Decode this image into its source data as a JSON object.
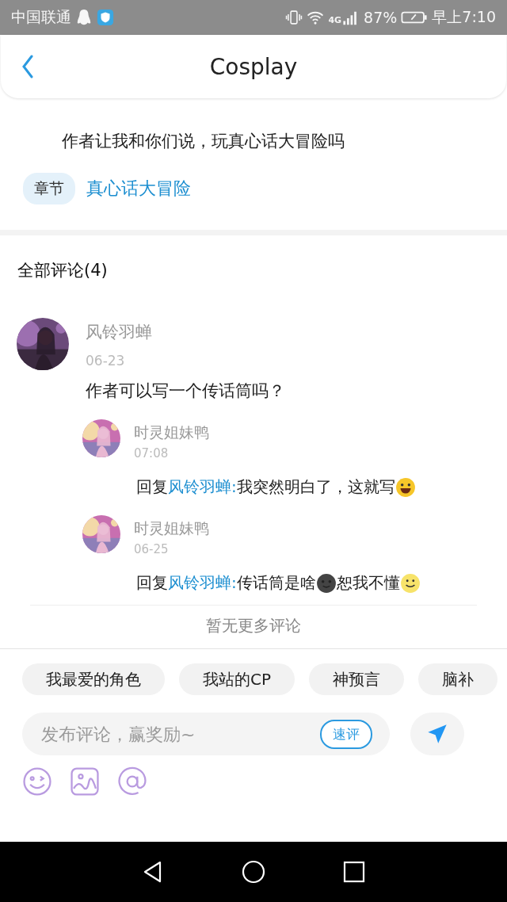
{
  "status_bar": {
    "carrier": "中国联通",
    "network": "4G",
    "battery": "87%",
    "time": "早上7:10"
  },
  "header": {
    "title": "Cosplay"
  },
  "post": {
    "text": "作者让我和你们说，玩真心话大冒险吗",
    "chapter_label": "章节",
    "chapter": "真心话大冒险"
  },
  "comments_title": "全部评论(4)",
  "comments": [
    {
      "author": "风铃羽蝉",
      "date": "06-23",
      "text": "作者可以写一个传话筒吗？",
      "replies": [
        {
          "author": "时灵姐妹鸭",
          "time": "07:08",
          "prefix": "回复",
          "mention": "风铃羽蝉:",
          "parts": [
            {
              "kind": "text",
              "text": "我突然明白了，这就写"
            },
            {
              "kind": "grin"
            }
          ]
        },
        {
          "author": "时灵姐妹鸭",
          "time": "06-25",
          "prefix": "回复",
          "mention": "风铃羽蝉:",
          "parts": [
            {
              "kind": "text",
              "text": "传话筒是啥"
            },
            {
              "kind": "moon"
            },
            {
              "kind": "text",
              "text": "恕我不懂"
            },
            {
              "kind": "smile"
            }
          ]
        }
      ]
    }
  ],
  "end_note": "暂无更多评论",
  "quick_tags": [
    "我最爱的角色",
    "我站的CP",
    "神预言",
    "脑补"
  ],
  "composer": {
    "placeholder": "发布评论，赢奖励~",
    "quick_button": "速评"
  }
}
